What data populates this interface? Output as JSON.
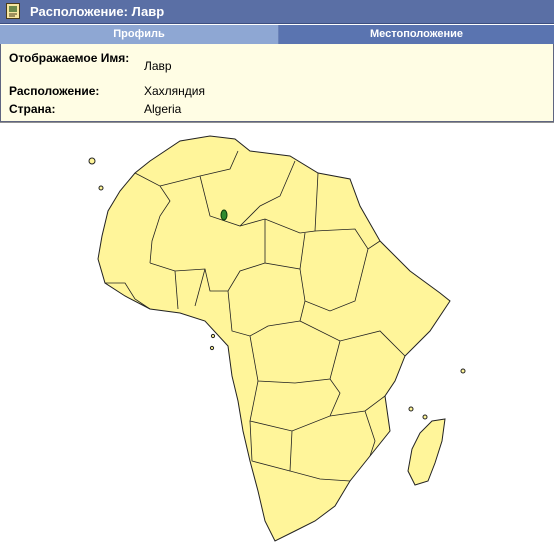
{
  "window": {
    "title": "Расположение: Лавр",
    "icon": "map-document-icon"
  },
  "tabs": [
    {
      "label": "Профиль",
      "active": false
    },
    {
      "label": "Местоположение",
      "active": true
    }
  ],
  "profile": {
    "display_name_label": "Отображаемое Имя:",
    "display_name_value": "Лавр",
    "location_label": "Расположение:",
    "location_value": "Хахляндия",
    "country_label": "Страна:",
    "country_value": "Algeria"
  },
  "map": {
    "region": "Africa",
    "highlight": "Algeria",
    "colors": {
      "land": "#fff59a",
      "border": "#222222",
      "marker": "#2f8a2f",
      "titlebar": "#5a6fa5"
    }
  }
}
